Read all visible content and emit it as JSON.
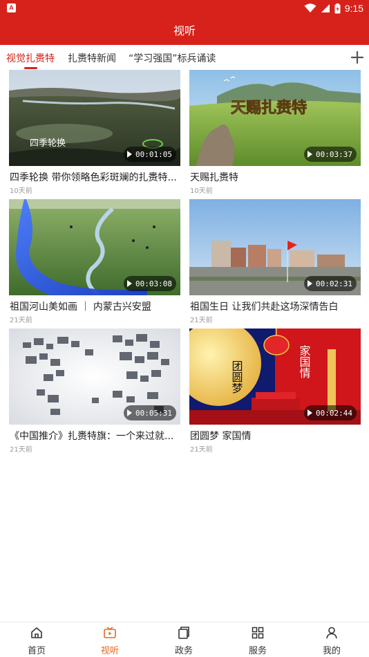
{
  "status_bar": {
    "time": "9:15",
    "app_icon_letter": "A"
  },
  "header": {
    "title": "视听"
  },
  "tabs": [
    {
      "label": "视觉扎赉特",
      "active": true
    },
    {
      "label": "扎赉特新闻",
      "active": false
    },
    {
      "label": "“学习强国”标兵诵读",
      "active": false
    }
  ],
  "videos": [
    {
      "title": "四季轮换  带你领略色彩斑斓的扎赉特...",
      "time": "10天前",
      "duration": "00:01:05",
      "overlay_text": "四季轮换"
    },
    {
      "title": "天赐扎赉特",
      "time": "10天前",
      "duration": "00:03:37",
      "overlay_text": "天赐扎赉特"
    },
    {
      "title": "祖国河山美如画  ｜  内蒙古兴安盟",
      "time": "21天前",
      "duration": "00:03:08"
    },
    {
      "title": "祖国生日  让我们共赴这场深情告白",
      "time": "21天前",
      "duration": "00:02:31"
    },
    {
      "title": "《中国推介》扎赉特旗：一个来过就...",
      "time": "21天前",
      "duration": "00:05:31"
    },
    {
      "title": "团圆梦  家国情",
      "time": "21天前",
      "duration": "00:02:44",
      "overlay_text_left": "团圆梦",
      "overlay_text_right": "家国情"
    }
  ],
  "bottom_nav": [
    {
      "label": "首页",
      "icon": "home-icon",
      "active": false
    },
    {
      "label": "视听",
      "icon": "video-icon",
      "active": true
    },
    {
      "label": "政务",
      "icon": "documents-icon",
      "active": false
    },
    {
      "label": "服务",
      "icon": "grid-icon",
      "active": false
    },
    {
      "label": "我的",
      "icon": "person-icon",
      "active": false
    }
  ],
  "colors": {
    "brand_red": "#d7221b",
    "active_nav": "#e8661e",
    "time_gray": "#999999"
  }
}
